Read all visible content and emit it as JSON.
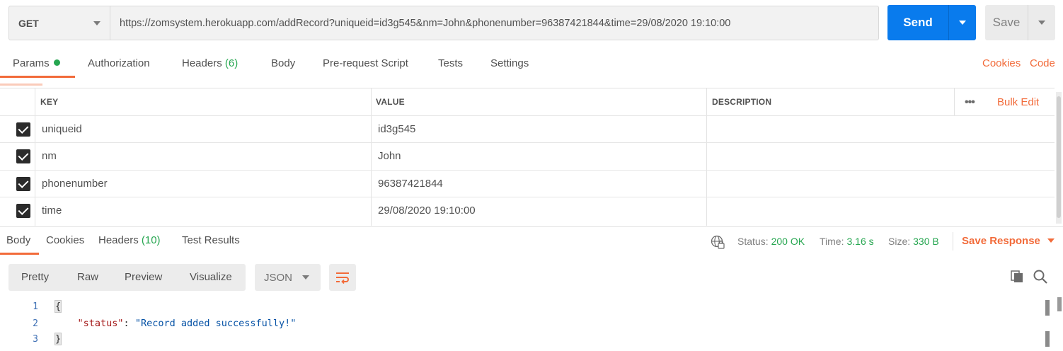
{
  "request": {
    "method": "GET",
    "url": "https://zomsystem.herokuapp.com/addRecord?uniqueid=id3g545&nm=John&phonenumber=96387421844&time=29/08/2020 19:10:00",
    "send_label": "Send",
    "save_label": "Save"
  },
  "request_tabs": {
    "params": "Params",
    "authorization": "Authorization",
    "headers": "Headers",
    "headers_count": "(6)",
    "body": "Body",
    "pre_request": "Pre-request Script",
    "tests": "Tests",
    "settings": "Settings",
    "cookies": "Cookies",
    "code": "Code"
  },
  "params_table": {
    "headers": {
      "key": "KEY",
      "value": "VALUE",
      "description": "DESCRIPTION"
    },
    "bulk_edit": "Bulk Edit",
    "rows": [
      {
        "checked": true,
        "key": "uniqueid",
        "value": "id3g545",
        "description": ""
      },
      {
        "checked": true,
        "key": "nm",
        "value": "John",
        "description": ""
      },
      {
        "checked": true,
        "key": "phonenumber",
        "value": "96387421844",
        "description": ""
      },
      {
        "checked": true,
        "key": "time",
        "value": "29/08/2020 19:10:00",
        "description": ""
      }
    ]
  },
  "response_tabs": {
    "body": "Body",
    "cookies": "Cookies",
    "headers": "Headers",
    "headers_count": "(10)",
    "test_results": "Test Results"
  },
  "response_status": {
    "status_label": "Status:",
    "status_value": "200 OK",
    "time_label": "Time:",
    "time_value": "3.16 s",
    "size_label": "Size:",
    "size_value": "330 B",
    "save_response": "Save Response"
  },
  "view": {
    "options": [
      "Pretty",
      "Raw",
      "Preview",
      "Visualize"
    ],
    "format": "JSON"
  },
  "code_lines": [
    {
      "n": "1",
      "text": "{"
    },
    {
      "n": "2",
      "key": "\"status\"",
      "sep": ": ",
      "value": "\"Record added successfully!\""
    },
    {
      "n": "3",
      "text": "}"
    }
  ],
  "colors": {
    "accent": "#f26b3a",
    "send": "#097bed",
    "success": "#26a650"
  },
  "icons": [
    "chevron-down-icon",
    "checkbox-checked-icon",
    "more-icon",
    "globe-lock-icon",
    "wrap-lines-icon",
    "copy-icon",
    "search-icon"
  ]
}
